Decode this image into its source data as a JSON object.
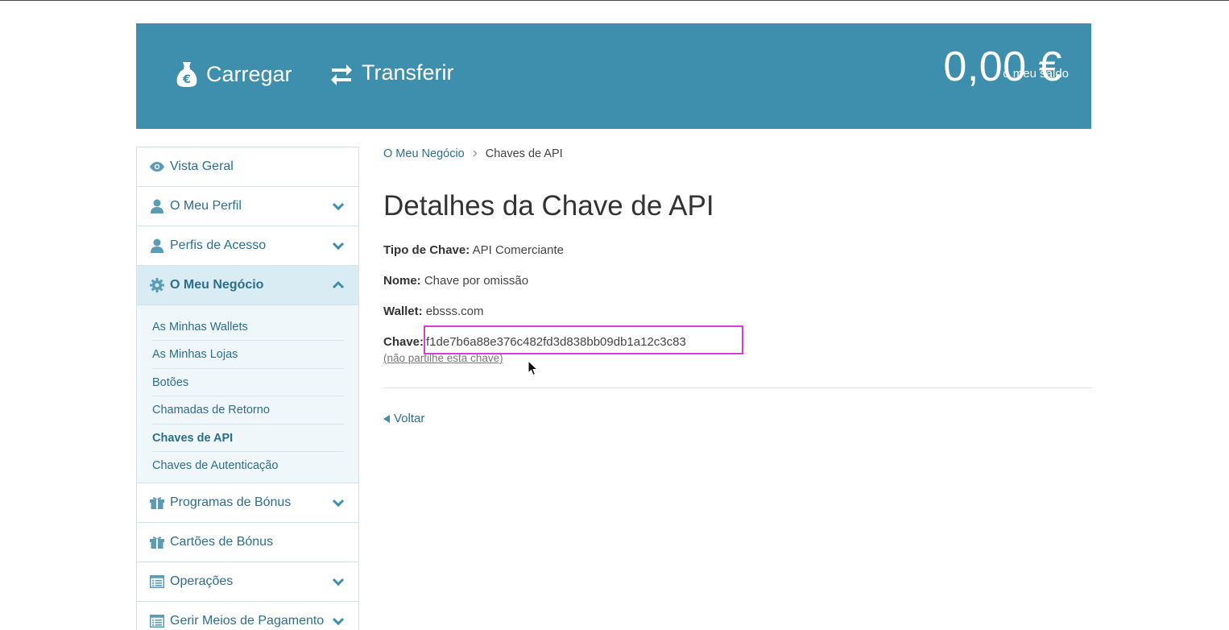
{
  "header": {
    "load_label": "Carregar",
    "transfer_label": "Transferir",
    "balance_amount": "0,00 €",
    "balance_label": "o meu saldo",
    "icons": {
      "load": "money-bag-euro-icon",
      "transfer": "transfer-arrows-icon"
    },
    "color": "#3d8fad"
  },
  "sidebar": {
    "items": [
      {
        "label": "Vista Geral",
        "icon": "eye-icon"
      },
      {
        "label": "O Meu Perfil",
        "icon": "user-icon"
      },
      {
        "label": "Perfis de Acesso",
        "icon": "user-icon"
      },
      {
        "label": "O Meu Negócio",
        "icon": "gear-icon"
      },
      {
        "label": "Programas de Bónus",
        "icon": "gift-icon"
      },
      {
        "label": "Cartões de Bónus",
        "icon": "gift-icon"
      },
      {
        "label": "Operações",
        "icon": "list-icon"
      },
      {
        "label": "Gerir Meios de Pagamento",
        "icon": "list-icon"
      }
    ],
    "subitems": [
      {
        "label": "As Minhas Wallets"
      },
      {
        "label": "As Minhas Lojas"
      },
      {
        "label": "Botões"
      },
      {
        "label": "Chamadas de Retorno"
      },
      {
        "label": "Chaves de API"
      },
      {
        "label": "Chaves de Autenticação"
      }
    ]
  },
  "breadcrumb": {
    "parent": "O Meu Negócio",
    "current": "Chaves de API"
  },
  "main": {
    "title": "Detalhes da Chave de API",
    "fields": {
      "type_label": "Tipo de Chave:",
      "type_value": "API Comerciante",
      "name_label": "Nome:",
      "name_value": "Chave por omissão",
      "wallet_label": "Wallet:",
      "wallet_value": "ebsss.com",
      "key_label": "Chave:",
      "key_value": "f1de7b6a88e376c482fd3d838bb09db1a12c3c83"
    },
    "warning": "(não partilhe esta chave)",
    "back_label": "Voltar"
  }
}
